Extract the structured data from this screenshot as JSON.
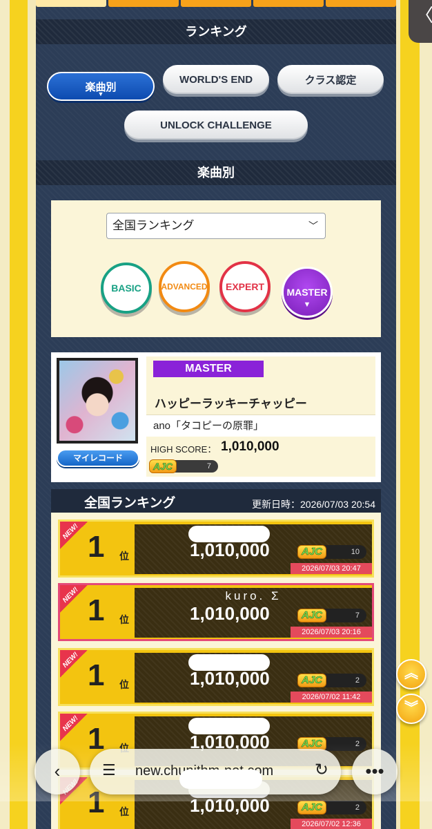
{
  "section_headers": {
    "ranking": "ランキング",
    "by_song": "楽曲別"
  },
  "mode_buttons": {
    "by_song": "楽曲別",
    "worlds_end": "WORLD'S END",
    "class": "クラス認定",
    "unlock": "UNLOCK CHALLENGE",
    "caret": "▼"
  },
  "filter": {
    "select_value": "全国ランキング",
    "difficulties": {
      "basic": "BASIC",
      "advanced": "ADVANCED",
      "expert": "EXPERT",
      "master": "MASTER"
    }
  },
  "song": {
    "difficulty": "MASTER",
    "title": "ハッピーラッキーチャッピー",
    "artist": "ano「タコピーの原罪」",
    "my_record_label": "マイレコード",
    "high_score_label": "HIGH SCORE：",
    "high_score": "1,010,000",
    "lamp": "AJC",
    "lamp_count": "7"
  },
  "ranking": {
    "title": "全国ランキング",
    "updated": "更新日時：2026/07/03 20:54",
    "rank_suffix": "位",
    "new_label": "NEW!",
    "rows": [
      {
        "rank": "1",
        "name": "",
        "score": "1,010,000",
        "lamp": "AJC",
        "count": "10",
        "date": "2026/07/03 20:47"
      },
      {
        "rank": "1",
        "name": "kuro. Σ",
        "score": "1,010,000",
        "lamp": "AJC",
        "count": "7",
        "date": "2026/07/03 20:16"
      },
      {
        "rank": "1",
        "name": "",
        "score": "1,010,000",
        "lamp": "AJC",
        "count": "2",
        "date": "2026/07/02 11:42"
      },
      {
        "rank": "1",
        "name": "",
        "score": "1,010,000",
        "lamp": "AJC",
        "count": "2",
        "date": ""
      },
      {
        "rank": "1",
        "name": "",
        "score": "1,010,000",
        "lamp": "AJC",
        "count": "2",
        "date": "2026/07/02 12:36"
      }
    ]
  },
  "browser": {
    "url": "new.chunithm-net.com"
  },
  "colors": {
    "accent_yellow": "#f6d21f",
    "panel_navy": "#2c3d57",
    "master_purple": "#8a22d8",
    "highlight_pink": "#e44a78"
  }
}
